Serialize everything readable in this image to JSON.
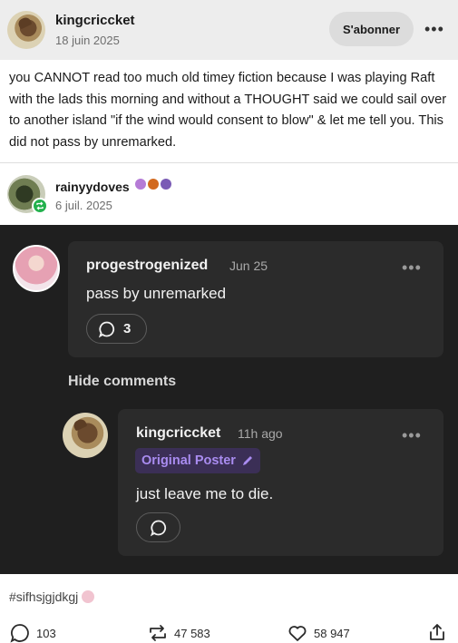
{
  "header": {
    "username": "kingcriccket",
    "date": "18 juin 2025",
    "subscribe_label": "S'abonner",
    "more_label": "•••"
  },
  "post": {
    "text": "you CANNOT read too much old timey fiction because I was playing Raft with the lads this morning and without a THOUGHT said we could sail over to another island \"if the wind would consent to blow\" & let me tell you. This did not pass by unremarked."
  },
  "reblog": {
    "username": "rainyydoves",
    "date": "6 juil. 2025",
    "badge_colors": [
      "#b57bd6",
      "#d2691e",
      "#7a5bb5"
    ]
  },
  "embedded": {
    "comment1": {
      "username": "progestrogenized",
      "time": "Jun 25",
      "text": "pass by unremarked",
      "reply_count": "3",
      "more_label": "•••"
    },
    "hide_comments_label": "Hide comments",
    "comment2": {
      "username": "kingcriccket",
      "time": "11h ago",
      "badge": "Original Poster",
      "text": "just leave me to die.",
      "more_label": "•••"
    }
  },
  "footer": {
    "tag": "#sifhsjgjdkgj",
    "comments_count": "103",
    "reblogs_count": "47 583",
    "likes_count": "58 947"
  },
  "colors": {
    "dark_bg": "#1f1f1f",
    "card_bg": "#2b2b2b",
    "op_badge_bg": "#3b2f56",
    "op_badge_text": "#a98cf0",
    "reblog_green": "#23b14d"
  }
}
